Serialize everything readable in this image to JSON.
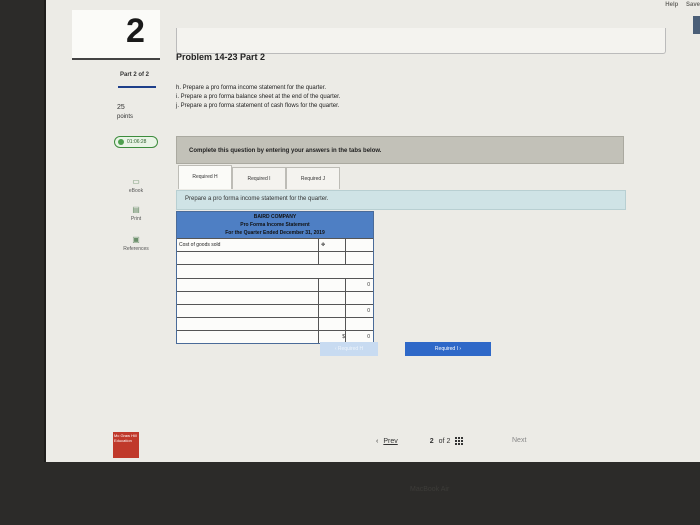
{
  "header": {
    "help": "Help",
    "save": "Save"
  },
  "question": {
    "number": "2",
    "title": "Problem 14-23 Part 2",
    "part": "Part 2 of 2",
    "points": "25",
    "points_label": "points",
    "timer": "01:06:28"
  },
  "instructions": [
    "h. Prepare a pro forma income statement for the quarter.",
    "i. Prepare a pro forma balance sheet at the end of the quarter.",
    "j. Prepare a pro forma statement of cash flows for the quarter."
  ],
  "directive": "Complete this question by entering your answers in the tabs below.",
  "tabs": [
    "Required H",
    "Required I",
    "Required J"
  ],
  "tab_prompt": "Prepare a pro forma income statement for the quarter.",
  "side_tools": [
    "eBook",
    "Print",
    "References"
  ],
  "statement": {
    "company": "BAIRD COMPANY",
    "name": "Pro Forma Income Statement",
    "period": "For the Quarter Ended December 31, 2019",
    "first_row": "Cost of goods sold",
    "subtotal_1": "0",
    "subtotal_2": "0",
    "total_symbol": "$",
    "total": "0"
  },
  "nav": {
    "prev": "Required H",
    "next": "Required I"
  },
  "pager": {
    "prev": "Prev",
    "current": "2",
    "of": "of 2",
    "next": "Next"
  },
  "logo": "Mc Graw Hill Education",
  "bezel": "MacBook Air"
}
